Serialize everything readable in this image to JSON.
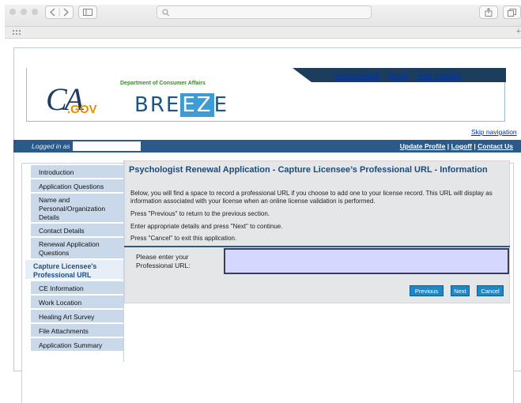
{
  "browser": {
    "address_text": ""
  },
  "header": {
    "nav_links": [
      "About BreEZe",
      "FAQ's",
      "Help Tutorials"
    ],
    "ca_logo": "CA",
    "ca_gov": ".GOV",
    "department": "Department of Consumer Affairs",
    "breeze_pre": "BRE",
    "breeze_ez": "EZ",
    "breeze_post": "E",
    "skip_navigation": "Skip navigation"
  },
  "status_bar": {
    "logged_in_label": "Logged in as",
    "update_profile": "Update Profile",
    "logoff": "Logoff",
    "contact_us": "Contact Us",
    "separator": "|"
  },
  "sidebar": {
    "items": [
      {
        "label": "Introduction"
      },
      {
        "label": "Application Questions"
      },
      {
        "label": "Name and Personal/Organization Details"
      },
      {
        "label": "Contact Details"
      },
      {
        "label": "Renewal Application Questions"
      },
      {
        "label": "Capture Licensee's Professional URL"
      },
      {
        "label": "CE Information"
      },
      {
        "label": "Work Location"
      },
      {
        "label": "Healing Art Survey"
      },
      {
        "label": "File Attachments"
      },
      {
        "label": "Application Summary"
      }
    ],
    "active_index": 5
  },
  "main": {
    "title": "Psychologist Renewal Application - Capture Licensee’s Professional URL - Information",
    "instructions": [
      "Below, you will find a space to record a professional URL if you choose to add one to your license record. This URL will display as information associated with your license when an online license validation is performed.",
      "Press \"Previous\" to return to the previous section.",
      "Enter appropriate details and press \"Next\" to continue.",
      "Press \"Cancel\" to exit this application."
    ],
    "url_label_line1": "Please enter your",
    "url_label_line2": "Professional URL:",
    "url_value": "",
    "buttons": {
      "previous": "Previous",
      "next": "Next",
      "cancel": "Cancel"
    }
  },
  "colors": {
    "header_nav": "#1d3d5c",
    "status_bar": "#2a5a8a",
    "sidebar_item": "#c9d9ea",
    "title": "#1d4a78",
    "button": "#1e88c7",
    "url_input": "#d4d8ff"
  }
}
